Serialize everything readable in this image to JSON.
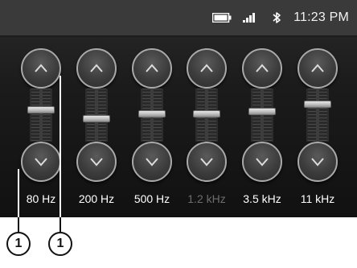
{
  "statusbar": {
    "time": "11:23 PM",
    "icons": [
      "battery-icon",
      "signal-icon",
      "bluetooth-icon"
    ]
  },
  "equalizer": {
    "bands": [
      {
        "label": "80 Hz",
        "level": 0.21,
        "enabled": true
      },
      {
        "label": "200 Hz",
        "level": -0.15,
        "enabled": true
      },
      {
        "label": "500 Hz",
        "level": 0.04,
        "enabled": true
      },
      {
        "label": "1.2 kHz",
        "level": 0.04,
        "enabled": false
      },
      {
        "label": "3.5 kHz",
        "level": 0.16,
        "enabled": true
      },
      {
        "label": "11 kHz",
        "level": 0.43,
        "enabled": true
      }
    ]
  },
  "callouts": [
    "1",
    "1"
  ],
  "colors": {
    "background": "#161616",
    "statusbar": "#3a3a3a",
    "disabled_text": "#6d6d6d"
  }
}
